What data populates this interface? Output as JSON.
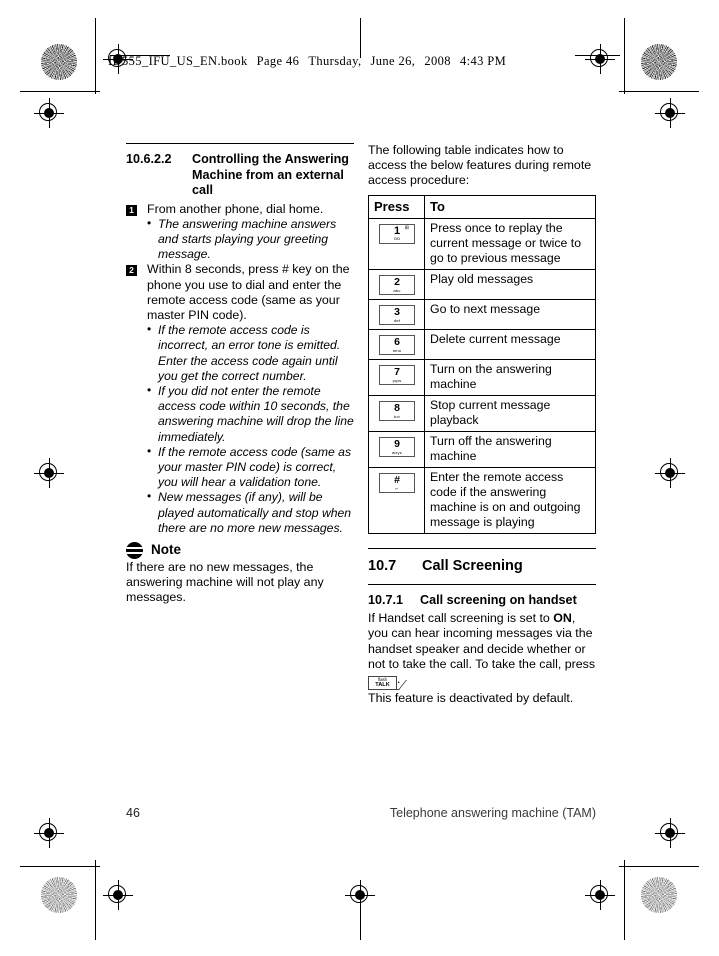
{
  "header": {
    "file": "ID555_IFU_US_EN.book",
    "page_label": "Page 46",
    "weekday": "Thursday,",
    "month_day": "June 26,",
    "year": "2008",
    "time": "4:43 PM"
  },
  "left_column": {
    "heading": {
      "number": "10.6.2.2",
      "title": "Controlling the Answering Machine from an external call"
    },
    "steps": [
      {
        "marker": "1",
        "text": "From another phone, dial home.",
        "bullets": [
          "The answering machine answers and starts playing your greeting message."
        ]
      },
      {
        "marker": "2",
        "text": "Within 8 seconds, press # key on the phone you use to dial and enter the remote access code (same as your master PIN code).",
        "bullets": [
          "If the remote access code is incorrect, an error tone is emitted. Enter the access code again until you get the correct number.",
          "If you did not enter the remote access code within 10 seconds, the answering machine will drop the line immediately.",
          "If the remote access code (same as your master PIN code) is correct, you will hear a validation tone.",
          "New messages (if any), will be played automatically and stop when there are no more new messages."
        ]
      }
    ],
    "note": {
      "icon": "note-icon",
      "title": "Note",
      "text": "If there are no new messages, the answering machine will not play any messages."
    }
  },
  "right_column": {
    "intro": "The following table indicates how to access the below features during remote access procedure:",
    "table": {
      "columns": [
        "Press",
        "To"
      ],
      "rows": [
        {
          "key": {
            "num": "1",
            "sub": "oo",
            "sup": "⊞"
          },
          "to": "Press once to replay the current message or twice to go to previous message"
        },
        {
          "key": {
            "num": "2",
            "sub": "abc"
          },
          "to": "Play old messages"
        },
        {
          "key": {
            "num": "3",
            "sub": "def"
          },
          "to": "Go to next message"
        },
        {
          "key": {
            "num": "6",
            "sub": "mno"
          },
          "to": "Delete current message"
        },
        {
          "key": {
            "num": "7",
            "sub": "pqrs"
          },
          "to": "Turn on the answering machine"
        },
        {
          "key": {
            "num": "8",
            "sub": "tuv"
          },
          "to": "Stop current message playback"
        },
        {
          "key": {
            "num": "9",
            "sub": "wxyz"
          },
          "to": "Turn off the answering machine"
        },
        {
          "key": {
            "num": "#",
            "sub": "↵"
          },
          "to": "Enter the remote access code if the answering machine is on and outgoing message is playing"
        }
      ]
    },
    "section": {
      "number": "10.7",
      "title": "Call Screening"
    },
    "subsection": {
      "number": "10.7.1",
      "title": "Call screening on handset"
    },
    "body_part1": "If Handset call screening is set to ",
    "body_on": "ON",
    "body_part2": ", you can hear incoming messages via the handset speaker and decide whether or not to take the call. To take the call, press ",
    "talk_key": {
      "flash": "flash",
      "talk": "TALK"
    },
    "body_part3": ".",
    "body_last": "This feature is deactivated by default."
  },
  "footer": {
    "page_number": "46",
    "section_title": "Telephone answering machine (TAM)"
  }
}
